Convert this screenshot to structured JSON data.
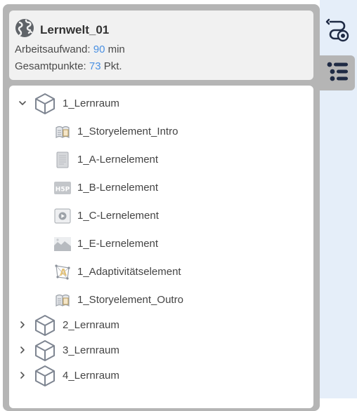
{
  "world": {
    "title": "Lernwelt_01",
    "icon": "globe-icon",
    "effort_label": "Arbeitsaufwand:",
    "effort_value": "90",
    "effort_unit": "min",
    "points_label": "Gesamtpunkte:",
    "points_value": "73",
    "points_unit": "Pkt."
  },
  "side_buttons": [
    {
      "icon": "route-target-icon",
      "active": false
    },
    {
      "icon": "list-icon",
      "active": true
    }
  ],
  "tree": {
    "rooms": [
      {
        "label": "1_Lernraum",
        "expanded": true,
        "elements": [
          {
            "label": "1_Storyelement_Intro",
            "icon": "story-icon"
          },
          {
            "label": "1_A-Lernelement",
            "icon": "text-document-icon"
          },
          {
            "label": "1_B-Lernelement",
            "icon": "h5p-icon"
          },
          {
            "label": "1_C-Lernelement",
            "icon": "video-icon"
          },
          {
            "label": "1_E-Lernelement",
            "icon": "image-icon"
          },
          {
            "label": "1_Adaptivitätselement",
            "icon": "adaptivity-icon"
          },
          {
            "label": "1_Storyelement_Outro",
            "icon": "story-icon"
          }
        ]
      },
      {
        "label": "2_Lernraum",
        "expanded": false
      },
      {
        "label": "3_Lernraum",
        "expanded": false
      },
      {
        "label": "4_Lernraum",
        "expanded": false
      }
    ]
  },
  "colors": {
    "accent_value": "#4a90e2",
    "frame": "#b5b5b5",
    "side_bg": "#e5eef9"
  }
}
